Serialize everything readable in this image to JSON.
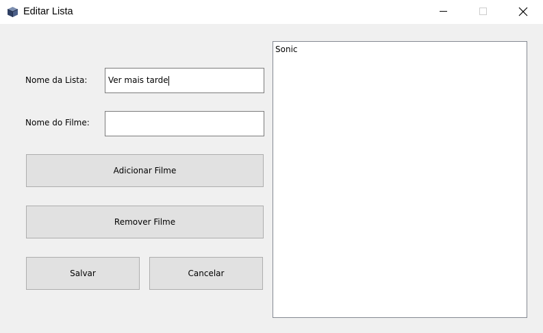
{
  "window": {
    "title": "Editar Lista",
    "controls": [
      "minimize",
      "maximize",
      "close"
    ]
  },
  "form": {
    "list_name_label": "Nome da Lista:",
    "list_name_value": "Ver mais tarde",
    "movie_name_label": "Nome do Filme:",
    "movie_name_value": ""
  },
  "buttons": {
    "add_movie": "Adicionar Filme",
    "remove_movie": "Remover Filme",
    "save": "Salvar",
    "cancel": "Cancelar"
  },
  "movie_list": {
    "items": [
      "Sonic"
    ]
  }
}
